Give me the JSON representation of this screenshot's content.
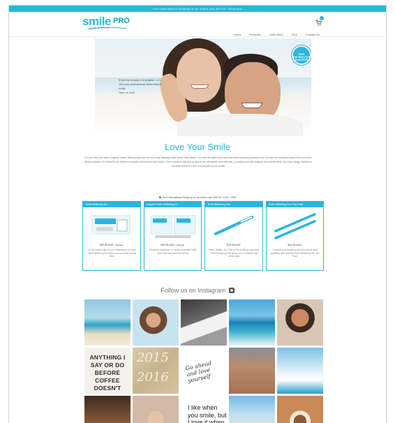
{
  "announcement": "Free International Shipping on all orders over $49.00 / Shop Now",
  "brand": {
    "logo_text": "smile",
    "logo_pro": "PRO",
    "tagline": "Smile Direct Co.",
    "accent_color": "#2cb5de"
  },
  "nav": {
    "items": [
      "Home",
      "Products",
      "Learn More",
      "FAQ",
      "Contact Us"
    ],
    "cart_icon": "cart-icon"
  },
  "hero": {
    "line1": "If like the beauty of a brighter",
    "line1_highlight": "smile",
    "line2": "Get your professional whitening kit today",
    "line3": "Take us now!",
    "seal_text": "100% SATISFACTION GUARANTEED"
  },
  "intro": {
    "title": "Love Your Smile",
    "body": "Do you wish you had a brighter smile? Most people are far from that naturally white smile they desire, but with the right procedure and teeth whitening product you can get the beautiful white smile you have always wanted. At SmilePro we believe everyone should love their smile. Our innovative kits and products are affordable and effective, providing you with brighter and whiter teeth. No more tangy, stained or off-white teeth! It's time to bring life to you smile!",
    "shipping_line": "Free International Shipping on all orders over $49.00 / 1300 - 0902"
  },
  "products": [
    {
      "title": "Teeth Whitening Kit",
      "price": "$49.95 AUD",
      "old_price": "$89.95",
      "desc": "Let the brilliant light of your whitening kit in home. Teeth Whitening Kit makes sure you smile at best effect."
    },
    {
      "title": "Couples Teeth Whitening Kit",
      "price": "$59.95 AUD",
      "old_price": "$99.95",
      "desc": "Share the experience of having a beautiful white smile with that someone special."
    },
    {
      "title": "Teeth Whitening Pen",
      "price": "$29.95 AUD",
      "old_price": "",
      "desc": "Brush, Whiten, Go. Pick up the on-the-go stain fixer. Teeth Whitening Pen allows you to maintain that white smile."
    },
    {
      "title": "Teeth Whitening Pen Two Pack",
      "price": "$49.95 AUD",
      "old_price": "",
      "desc": "Continue your treatment and keep those teeth sparkling white with the Teeth Whitening Pen Two Pack."
    }
  ],
  "instagram": {
    "title": "Follow us on Instagram",
    "camera_icon": "instagram-icon",
    "tile_texts": {
      "coffee": "ANYTHING I SAY OR DO BEFORE COFFEE DOESN'T COUNT.",
      "year_a": "2015",
      "year_b": "2016",
      "script": "Go ahead and love yourself",
      "quote": "I like when you smile, but I love it when I'm the reason."
    }
  }
}
